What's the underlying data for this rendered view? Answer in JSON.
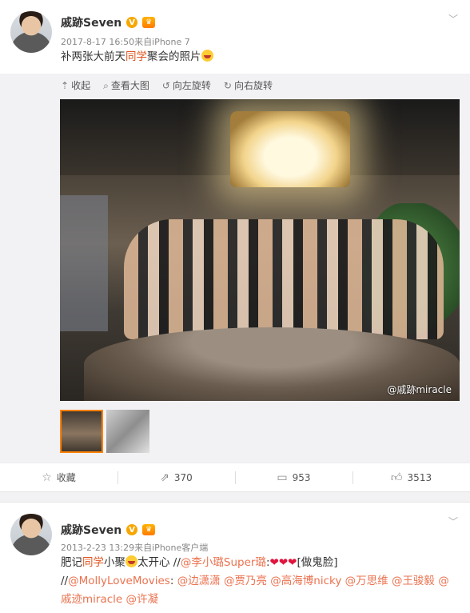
{
  "post1": {
    "author": "戚跡Seven",
    "meta": "2017-8-17 16:50来自iPhone 7",
    "text_before": "补两张大前天",
    "text_highlight": "同学",
    "text_after": "聚会的照片",
    "media_toolbar": [
      "收起",
      "查看大图",
      "向左旋转",
      "向右旋转"
    ],
    "watermark": "@戚跡miracle",
    "actions": [
      {
        "label": "收藏",
        "icon": "star-icon"
      },
      {
        "label": "370",
        "icon": "repost-icon"
      },
      {
        "label": "953",
        "icon": "comment-icon"
      },
      {
        "label": "3513",
        "icon": "like-icon"
      }
    ]
  },
  "post2": {
    "author": "戚跡Seven",
    "meta": "2013-2-23 13:29来自iPhone客户端",
    "line1_a": "肥记",
    "line1_hl": "同学",
    "line1_b": "小聚",
    "line1_c": "太开心 //",
    "mention1": "@李小璐Super璐",
    "line1_d": ":",
    "line1_e": "[做鬼脸]",
    "line2_a": "//",
    "mentions": [
      "@MollyLoveMovies",
      "@边潇潇",
      "@贾乃亮",
      "@高海博nicky",
      "@万思维",
      "@王骏毅",
      "@戚迹miracle",
      "@许凝"
    ]
  },
  "colors": {
    "accent": "#eb7350",
    "highlight": "#e0531d",
    "badge": "#f7a700"
  }
}
